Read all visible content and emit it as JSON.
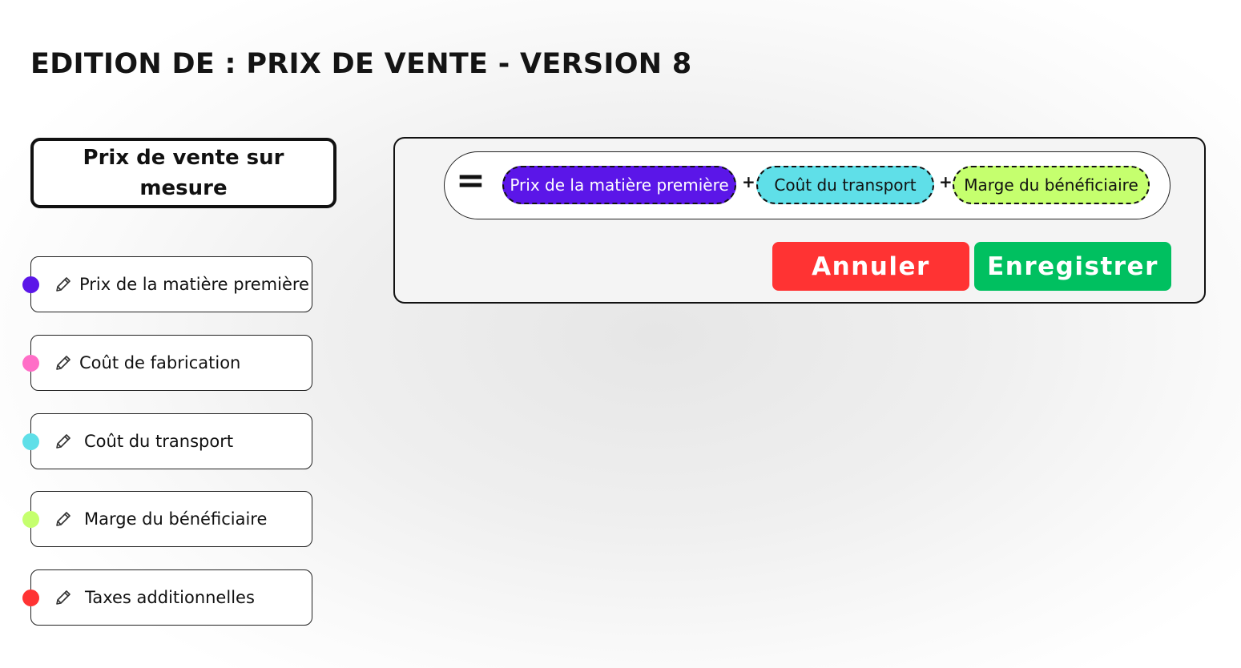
{
  "page": {
    "title": "EDITION DE : PRIX DE VENTE - VERSION 8"
  },
  "variable": {
    "name": "Prix de vente sur mesure"
  },
  "variables": [
    {
      "label": "Prix de la matière première",
      "color": "#5b16e8",
      "edit_icon": "pencil-icon"
    },
    {
      "label": "Coût de fabrication",
      "color": "#ff6ec7",
      "edit_icon": "pencil-icon"
    },
    {
      "label": "Coût du transport",
      "color": "#5fdfe8",
      "edit_icon": "pencil-icon"
    },
    {
      "label": "Marge du bénéficiaire",
      "color": "#c5ff6e",
      "edit_icon": "pencil-icon"
    },
    {
      "label": "Taxes additionnelles",
      "color": "#ff3333",
      "edit_icon": "pencil-icon"
    }
  ],
  "formula": {
    "equals": "=",
    "tokens": [
      {
        "label": "Prix de la matière première",
        "color": "#5b16e8",
        "text_color": "#ffffff"
      },
      {
        "label": "Coût du transport",
        "color": "#5fdfe8",
        "text_color": "#111111"
      },
      {
        "label": "Marge du bénéficiaire",
        "color": "#c5ff6e",
        "text_color": "#111111"
      }
    ],
    "operators": [
      "+",
      "+"
    ]
  },
  "actions": {
    "cancel_label": "Annuler",
    "cancel_color": "#ff3333",
    "save_label": "Enregistrer",
    "save_color": "#00c060"
  }
}
